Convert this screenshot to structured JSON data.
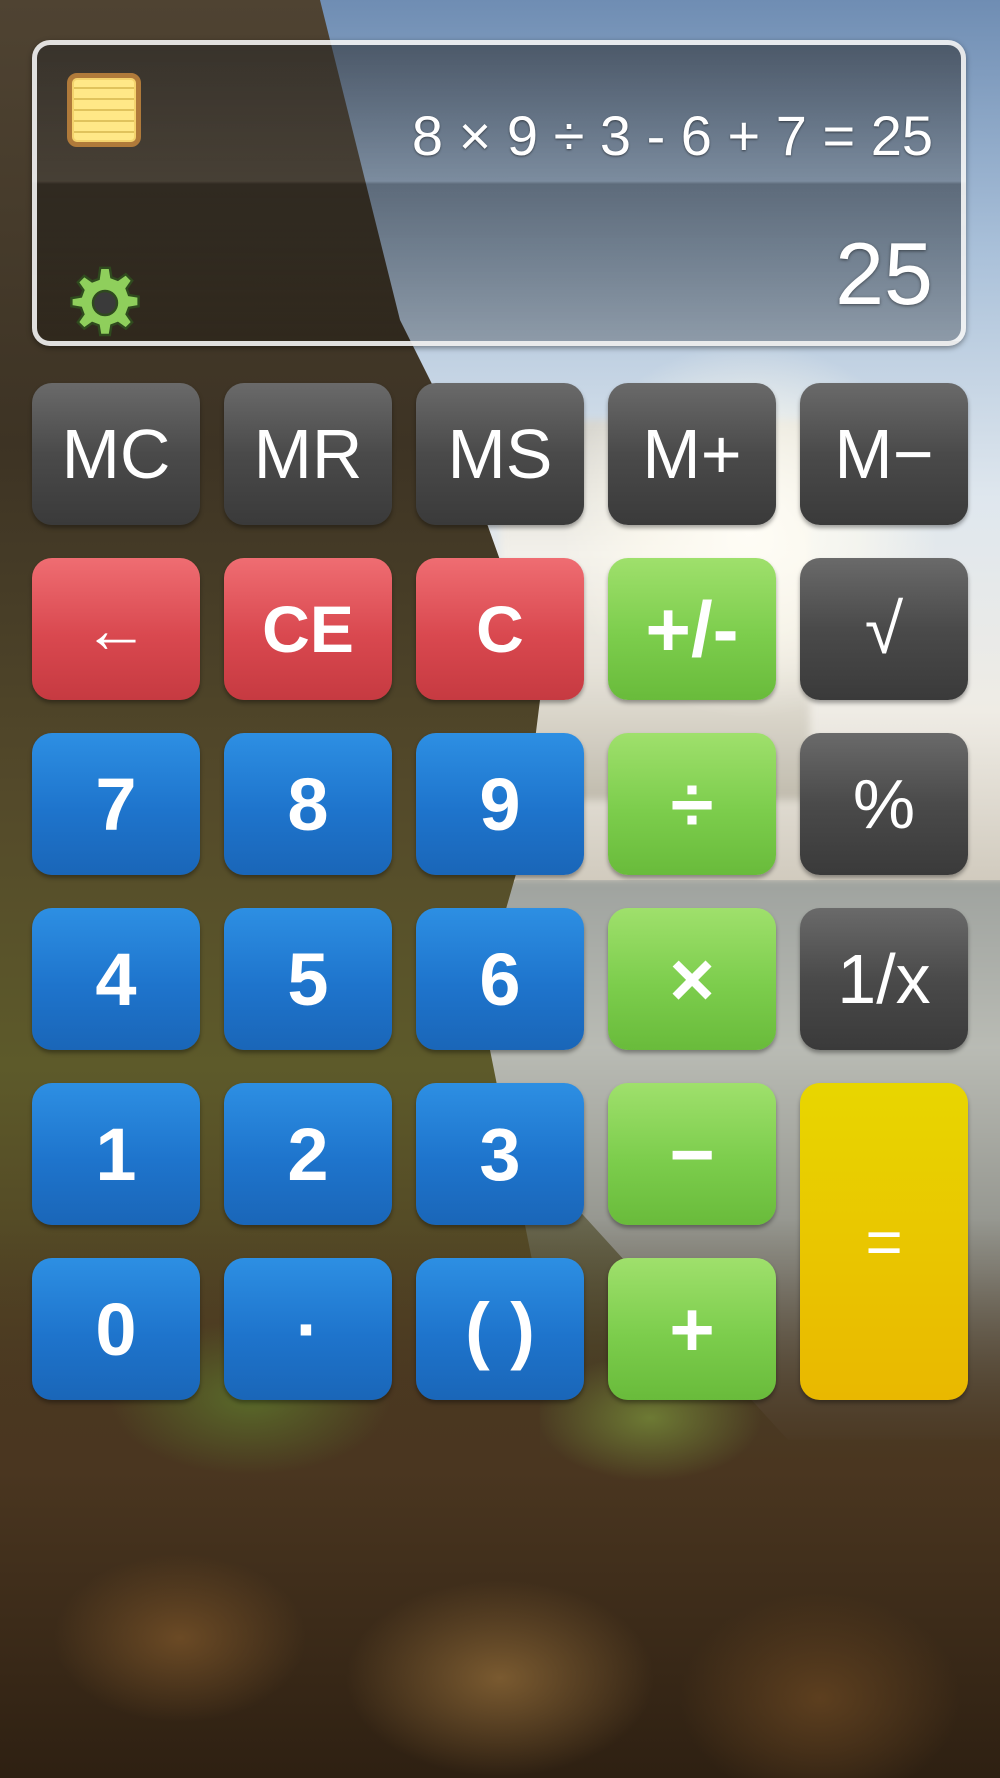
{
  "display": {
    "expression": "8 × 9 ÷ 3 - 6 + 7 = 25",
    "result": "25"
  },
  "icons": {
    "history": "notes-icon",
    "settings": "gear-icon"
  },
  "keys": {
    "mc": "MC",
    "mr": "MR",
    "ms": "MS",
    "m_plus": "M+",
    "m_minus": "M−",
    "backspace": "←",
    "ce": "CE",
    "clear": "C",
    "sign": "+/-",
    "sqrt": "√",
    "seven": "7",
    "eight": "8",
    "nine": "9",
    "divide": "÷",
    "percent": "%",
    "four": "4",
    "five": "5",
    "six": "6",
    "multiply": "×",
    "reciprocal": "1/x",
    "one": "1",
    "two": "2",
    "three": "3",
    "minus": "−",
    "equals": "=",
    "zero": "0",
    "decimal": "·",
    "parens": "( )",
    "plus": "+"
  },
  "colors": {
    "memory_keys": "#4a4a4a",
    "clear_keys": "#d9484f",
    "operator_keys": "#7ccd4c",
    "digit_keys": "#1e74cc",
    "equals_key": "#e9c500"
  }
}
